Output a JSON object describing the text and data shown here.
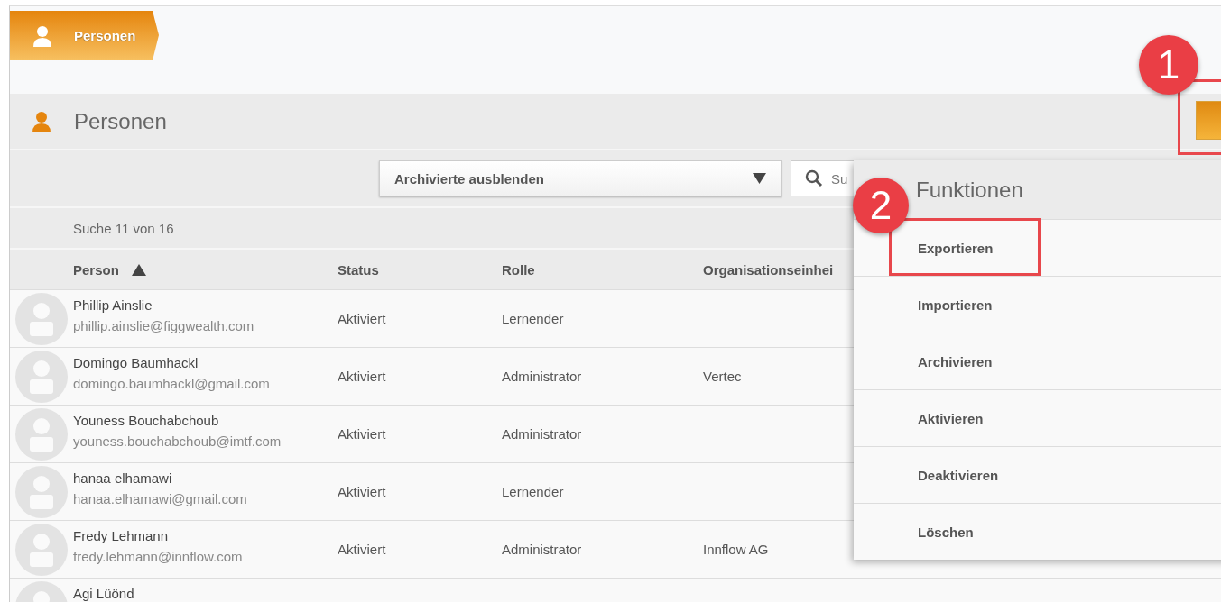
{
  "breadcrumb": {
    "label": "Personen"
  },
  "panel": {
    "title": "Personen",
    "function_button": {
      "highlighted": true
    }
  },
  "filter": {
    "value": "Archivierte ausblenden"
  },
  "search": {
    "placeholder": "Su"
  },
  "result_count": "Suche 11 von 16",
  "columns": [
    {
      "label": "Person",
      "sorted": true
    },
    {
      "label": "Status",
      "sorted": false
    },
    {
      "label": "Rolle",
      "sorted": false
    },
    {
      "label": "Organisationseinhei",
      "sorted": false
    }
  ],
  "rows": [
    {
      "name": "Phillip Ainslie",
      "email": "phillip.ainslie@figgwealth.com",
      "status": "Aktiviert",
      "role": "Lernender"
    },
    {
      "name": "Domingo Baumhackl",
      "email": "domingo.baumhackl@gmail.com",
      "status": "Aktiviert",
      "role": "Administrator",
      "org": "Vertec"
    },
    {
      "name": "Youness Bouchabchoub",
      "email": "youness.bouchabchoub@imtf.com",
      "status": "Aktiviert",
      "role": "Administrator"
    },
    {
      "name": "hanaa elhamawi",
      "email": "hanaa.elhamawi@gmail.com",
      "status": "Aktiviert",
      "role": "Lernender"
    },
    {
      "name": "Fredy Lehmann",
      "email": "fredy.lehmann@innflow.com",
      "status": "Aktiviert",
      "role": "Administrator",
      "org": "Innflow AG"
    },
    {
      "name": "Agi Lüönd"
    }
  ],
  "menu": {
    "title": "Funktionen",
    "items": [
      {
        "label": "Exportieren",
        "highlighted": true
      },
      {
        "label": "Importieren",
        "highlighted": false
      },
      {
        "label": "Archivieren",
        "highlighted": false
      },
      {
        "label": "Aktivieren",
        "highlighted": false
      },
      {
        "label": "Deaktivieren",
        "highlighted": false
      },
      {
        "label": "Löschen",
        "highlighted": false
      }
    ]
  },
  "annotations": [
    {
      "label": "1"
    },
    {
      "label": "2"
    }
  ]
}
